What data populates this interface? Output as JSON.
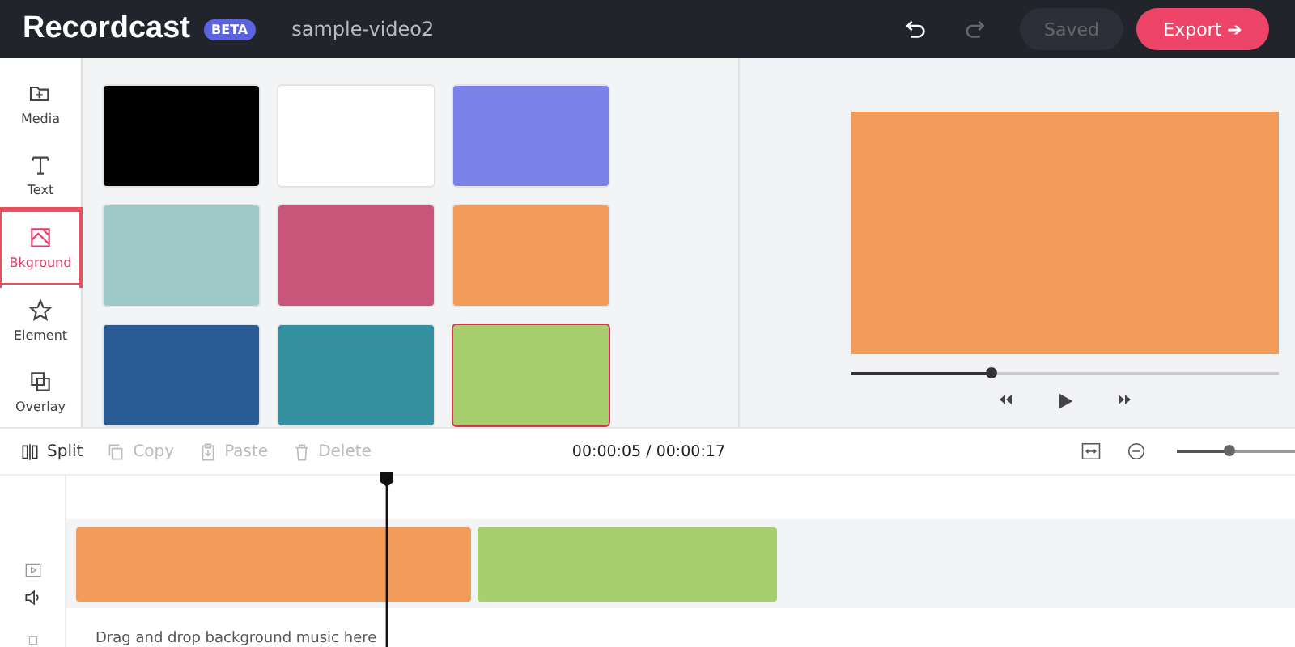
{
  "header": {
    "logo": "Recordcast",
    "badge": "BETA",
    "project_name": "sample-video2",
    "saved_button": {
      "label": "Saved",
      "disabled": true
    },
    "export_button": {
      "label": "Export ➔"
    }
  },
  "sidebar": {
    "items": [
      {
        "kind": "media",
        "label": "Media",
        "selected": false
      },
      {
        "kind": "text",
        "label": "Text",
        "selected": false
      },
      {
        "kind": "background",
        "label": "Bkground",
        "selected": true
      },
      {
        "kind": "element",
        "label": "Element",
        "selected": false
      },
      {
        "kind": "overlay",
        "label": "Overlay",
        "selected": false
      }
    ]
  },
  "swatches": [
    {
      "color": "#000000",
      "selected": false
    },
    {
      "color": "#ffffff",
      "selected": false
    },
    {
      "color": "#7b82e8",
      "selected": false
    },
    {
      "color": "#9fc9c9",
      "selected": false
    },
    {
      "color": "#c9557a",
      "selected": false
    },
    {
      "color": "#f39c5a",
      "selected": false
    },
    {
      "color": "#2a5a94",
      "selected": false
    },
    {
      "color": "#3590a0",
      "selected": false
    },
    {
      "color": "#a8cf6e",
      "selected": true
    }
  ],
  "preview": {
    "color": "#f39c5a",
    "scrubber": {
      "level": 0.33
    }
  },
  "toolbar": {
    "tools": [
      {
        "kind": "split",
        "label": "Split",
        "disabled": false
      },
      {
        "kind": "copy",
        "label": "Copy",
        "disabled": true
      },
      {
        "kind": "paste",
        "label": "Paste",
        "disabled": true
      },
      {
        "kind": "delete",
        "label": "Delete",
        "disabled": true
      }
    ],
    "timecode": "00:00:05 / 00:00:17",
    "zoom": {
      "level": 0.45
    }
  },
  "timeline": {
    "clips": [
      {
        "color": "#f39c5a"
      },
      {
        "color": "#a8cf6e"
      }
    ],
    "music_hint": "Drag and drop background music here"
  }
}
